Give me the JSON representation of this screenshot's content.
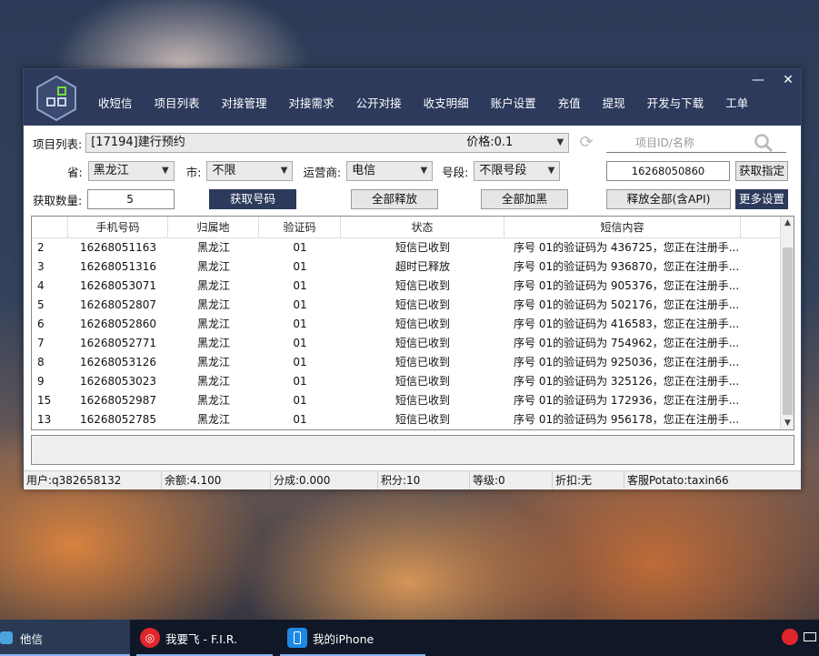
{
  "menu": [
    "收短信",
    "项目列表",
    "对接管理",
    "对接需求",
    "公开对接",
    "收支明细",
    "账户设置",
    "充值",
    "提现",
    "开发与下载",
    "工单"
  ],
  "window_controls": {
    "minimize": "—",
    "close": "✕"
  },
  "project": {
    "label": "项目列表:",
    "value": "[17194]建行预约",
    "price": "价格:0.1",
    "search_placeholder": "项目ID/名称"
  },
  "region": {
    "province_label": "省:",
    "province_value": "黑龙江",
    "city_label": "市:",
    "city_value": "不限",
    "carrier_label": "运营商:",
    "carrier_value": "电信",
    "segment_label": "号段:",
    "segment_value": "不限号段",
    "specified_number": "16268050860",
    "get_specified_button": "获取指定"
  },
  "actions": {
    "quantity_label": "获取数量:",
    "quantity_value": "5",
    "get_number": "获取号码",
    "release_all": "全部释放",
    "blacklist_all": "全部加黑",
    "release_all_api": "释放全部(含API)",
    "more_settings": "更多设置"
  },
  "table": {
    "headers": [
      "",
      "手机号码",
      "归属地",
      "验证码",
      "状态",
      "短信内容"
    ],
    "rows": [
      [
        "2",
        "16268051163",
        "黑龙江",
        "01",
        "短信已收到",
        "序号 01的验证码为 436725，您正在注册手..."
      ],
      [
        "3",
        "16268051316",
        "黑龙江",
        "01",
        "超时已释放",
        "序号 01的验证码为 936870，您正在注册手..."
      ],
      [
        "4",
        "16268053071",
        "黑龙江",
        "01",
        "短信已收到",
        "序号 01的验证码为 905376，您正在注册手..."
      ],
      [
        "5",
        "16268052807",
        "黑龙江",
        "01",
        "短信已收到",
        "序号 01的验证码为 502176，您正在注册手..."
      ],
      [
        "6",
        "16268052860",
        "黑龙江",
        "01",
        "短信已收到",
        "序号 01的验证码为 416583，您正在注册手..."
      ],
      [
        "7",
        "16268052771",
        "黑龙江",
        "01",
        "短信已收到",
        "序号 01的验证码为 754962，您正在注册手..."
      ],
      [
        "8",
        "16268053126",
        "黑龙江",
        "01",
        "短信已收到",
        "序号 01的验证码为 925036，您正在注册手..."
      ],
      [
        "9",
        "16268053023",
        "黑龙江",
        "01",
        "短信已收到",
        "序号 01的验证码为 325126，您正在注册手..."
      ],
      [
        "15",
        "16268052987",
        "黑龙江",
        "01",
        "短信已收到",
        "序号 01的验证码为 172936，您正在注册手..."
      ],
      [
        "13",
        "16268052785",
        "黑龙江",
        "01",
        "短信已收到",
        "序号 01的验证码为 956178，您正在注册手..."
      ]
    ]
  },
  "status": {
    "user": "用户:q382658132",
    "balance": "余额:4.100",
    "commission": "分成:0.000",
    "points": "积分:10",
    "level": "等级:0",
    "discount": "折扣:无",
    "support": "客服Potato:taxin66"
  },
  "taskbar": {
    "app1": "他信",
    "app2": "我要飞 - F.I.R.",
    "app3": "我的iPhone"
  },
  "colors": {
    "titlebar": "#2d3a5c",
    "accent_button": "#2d3a5c",
    "taskbar": "#101827"
  }
}
